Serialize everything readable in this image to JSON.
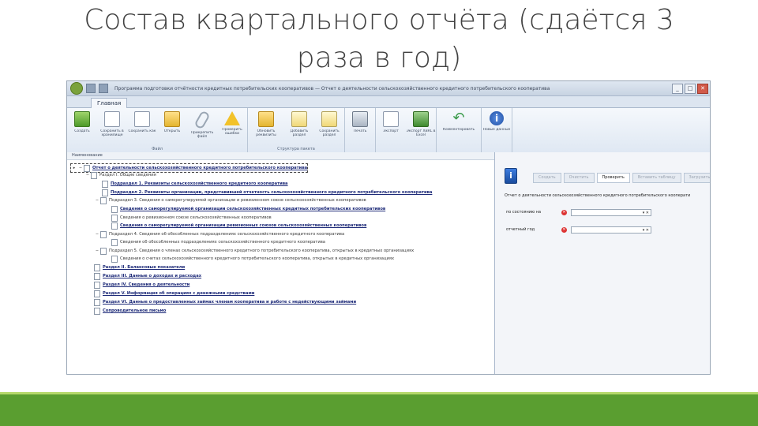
{
  "slide": {
    "title_line1": "Состав квартального отчёта (сдаётся 3",
    "title_line2": "раза в год)"
  },
  "app": {
    "window_title": "Программа подготовки отчётности кредитных потребительских кооперативов — Отчет о деятельности сельскохозяйственного кредитного потребительского кооператива",
    "tab_main": "Главная",
    "ribbon": {
      "buttons": [
        {
          "label": "Создать",
          "icon": "new-document-icon"
        },
        {
          "label": "Сохранить в хранилище",
          "icon": "save-icon"
        },
        {
          "label": "Сохранить как",
          "icon": "save-as-icon"
        },
        {
          "label": "Открыть",
          "icon": "open-folder-icon"
        },
        {
          "label": "Прикрепить файл",
          "icon": "attach-icon"
        },
        {
          "label": "Проверить ошибки",
          "icon": "warning-icon"
        },
        {
          "label": "Обновить реквизиты документа",
          "icon": "folder-icon"
        },
        {
          "label": "Добавить раздел",
          "icon": "add-section-icon"
        },
        {
          "label": "Сохранить раздел",
          "icon": "section-icon"
        },
        {
          "label": "Печать",
          "icon": "print-icon"
        },
        {
          "label": "Экспорт",
          "icon": "export-icon"
        },
        {
          "label": "Экспорт XBRL в Excel",
          "icon": "excel-icon"
        },
        {
          "label": "Комментировать",
          "icon": "undo-icon"
        },
        {
          "label": "Новые данные",
          "icon": "info-icon"
        }
      ],
      "group_file": "Файл",
      "group_structure": "Структура пакета"
    },
    "tree": {
      "header": "Наименование",
      "rows": [
        {
          "text": "Отчет о деятельности сельскохозяйственного кредитного потребительского кооператива",
          "level": 0
        },
        {
          "text": "Раздел I. Общие сведения",
          "level": 1
        },
        {
          "text": "Подраздел 1. Реквизиты сельскохозяйственного кредитного кооператива",
          "level": 2
        },
        {
          "text": "Подраздел 2. Реквизиты организации, представившей отчетность сельскохозяйственного кредитного потребительского кооператива",
          "level": 2
        },
        {
          "text": "Подраздел 3. Сведения о саморегулируемой организации и ревизионном союзе сельскохозяйственных кооперативов",
          "level": 2
        },
        {
          "text": "Сведения о саморегулируемой организации сельскохозяйственных кредитных потребительских кооперативов",
          "level": 3
        },
        {
          "text": "Сведения о ревизионном союзе сельскохозяйственных кооперативов",
          "level": 3
        },
        {
          "text": "Сведения о саморегулируемой организации ревизионных союзов сельскохозяйственных кооперативов",
          "level": 3
        },
        {
          "text": "Подраздел 4. Сведения об обособленных подразделениях сельскохозяйственного кредитного кооператива",
          "level": 2
        },
        {
          "text": "Сведения об обособленных подразделениях сельскохозяйственного кредитного кооператива",
          "level": 3
        },
        {
          "text": "Подраздел 5. Сведения о членах сельскохозяйственного кредитного потребительского кооператива, открытых в кредитных организациях",
          "level": 2
        },
        {
          "text": "Сведения о счетах сельскохозяйственного кредитного потребительского кооператива, открытых в кредитных организациях",
          "level": 3
        },
        {
          "text": "Раздел II. Балансовые показатели",
          "level": 1
        },
        {
          "text": "Раздел III. Данные о доходах и расходах",
          "level": 1
        },
        {
          "text": "Раздел IV. Сведения о деятельности",
          "level": 1
        },
        {
          "text": "Раздел V. Информация об операциях с денежными средствами",
          "level": 1
        },
        {
          "text": "Раздел VI. Данные о предоставленных займах членам кооператива и работе с недействующими займами",
          "level": 1
        },
        {
          "text": "Сопроводительное письмо",
          "level": 1
        }
      ]
    },
    "right_panel": {
      "tabs": [
        "Создать",
        "Очистить",
        "Проверить",
        "Вставить таблицу",
        "Загрузить"
      ],
      "active_tab": "Проверить",
      "title": "Отчет о деятельности сельскохозяйственного кредитного потребительского кооперати",
      "fields": [
        {
          "label": "по состоянию на",
          "value": "▾  ✕"
        },
        {
          "label": "отчетный год",
          "value": "▾  ✕"
        }
      ]
    }
  },
  "colors": {
    "bottom_band": "#5a9e30",
    "bottom_line": "#b5d96a",
    "link": "#1d2a78"
  }
}
